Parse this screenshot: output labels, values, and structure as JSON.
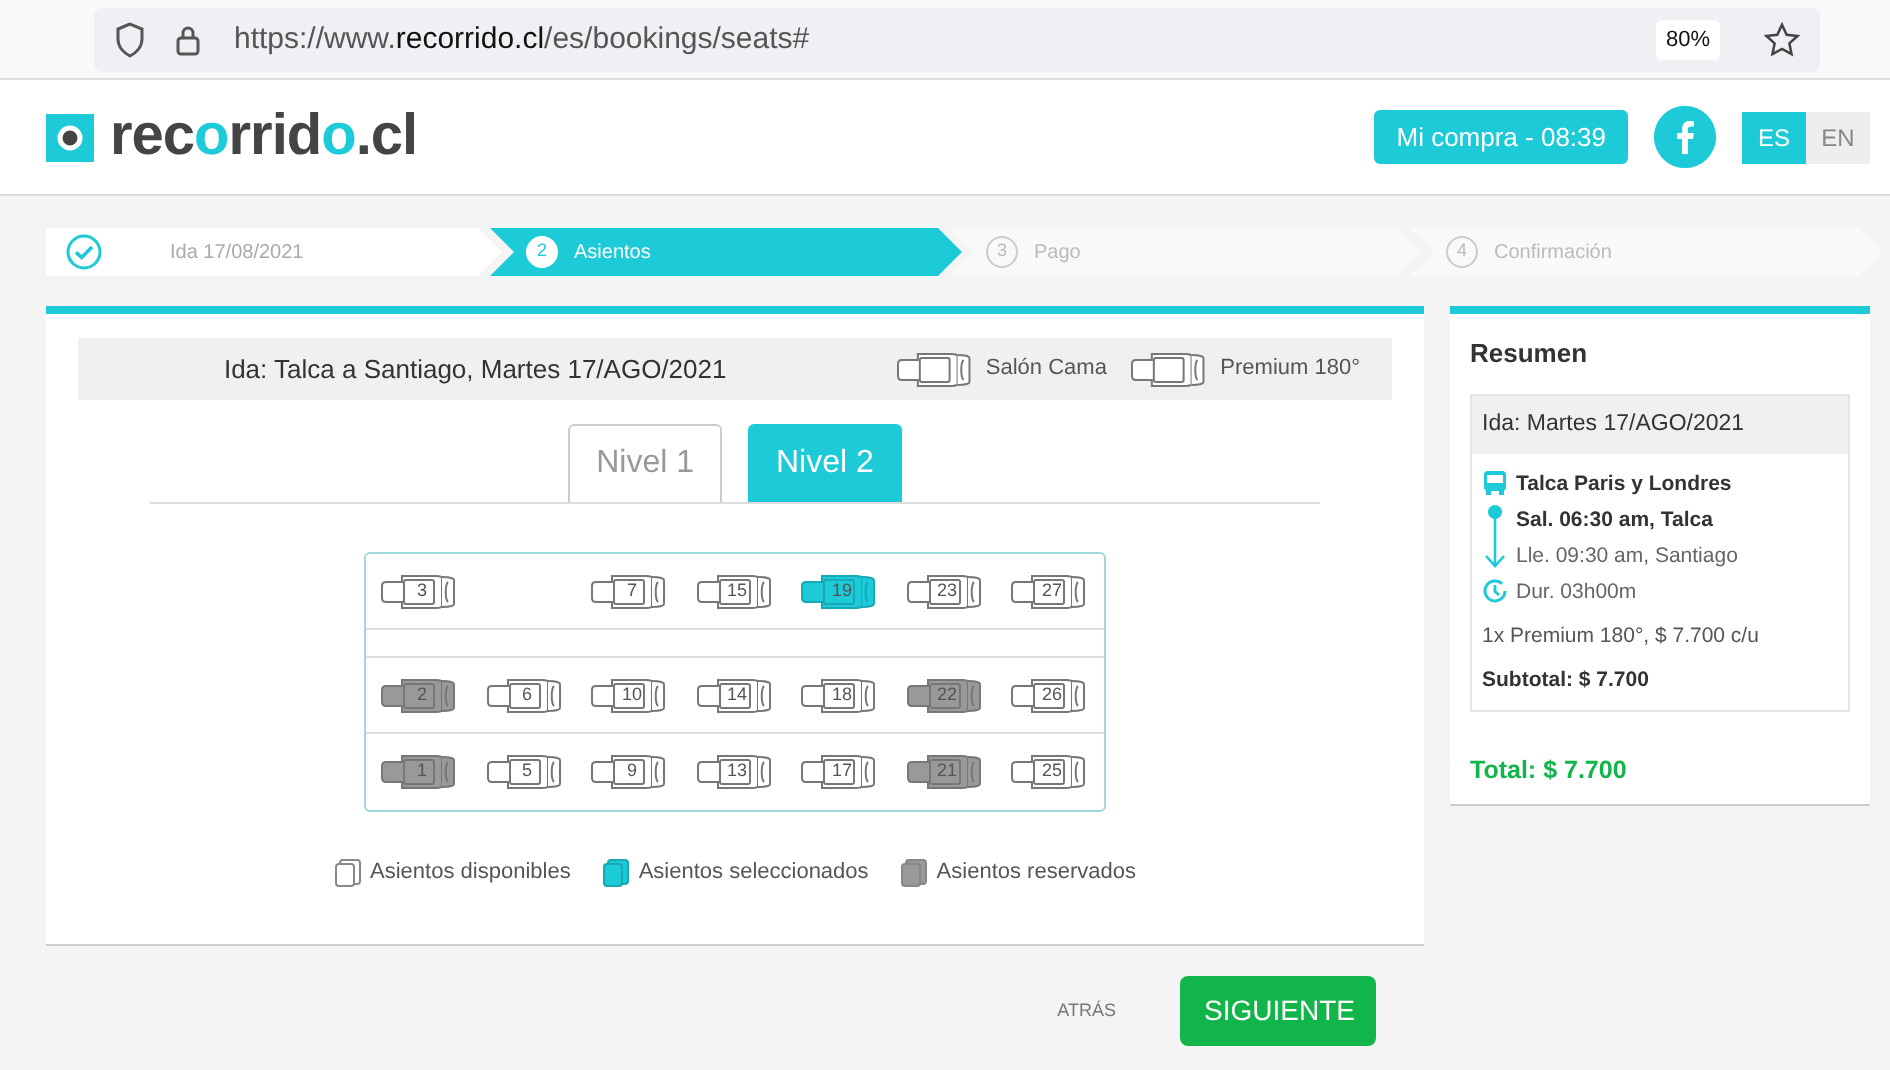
{
  "browser": {
    "url_prefix": "https://www.",
    "url_domain": "recorrido.cl",
    "url_path": "/es/bookings/seats#",
    "zoom": "80%"
  },
  "header": {
    "logo_parts": [
      "rec",
      "o",
      "rrid",
      "o",
      ".cl"
    ],
    "cart_button": "Mi compra - 08:39",
    "languages": [
      {
        "label": "ES",
        "selected": true
      },
      {
        "label": "EN",
        "selected": false
      }
    ]
  },
  "steps": [
    {
      "label": "Ida 17/08/2021",
      "completed": true,
      "selected": false
    },
    {
      "number": "2",
      "label": "Asientos",
      "completed": false,
      "selected": true
    },
    {
      "number": "3",
      "label": "Pago",
      "completed": false,
      "selected": false
    },
    {
      "number": "4",
      "label": "Confirmación",
      "completed": false,
      "selected": false
    }
  ],
  "trip_bar": {
    "title": "Ida: Talca a Santiago, Martes 17/AGO/2021",
    "seat_types": [
      "Salón Cama",
      "Premium 180°"
    ]
  },
  "levels": [
    {
      "label": "Nivel 1",
      "selected": false
    },
    {
      "label": "Nivel 2",
      "selected": true
    }
  ],
  "seat_rows": [
    [
      {
        "kind": "seat",
        "number": "3",
        "selected": false,
        "reserved": false
      },
      {
        "kind": "gap"
      },
      {
        "kind": "seat",
        "number": "7",
        "selected": false,
        "reserved": false
      },
      {
        "kind": "seat",
        "number": "15",
        "selected": false,
        "reserved": false
      },
      {
        "kind": "seat",
        "number": "19",
        "selected": true,
        "reserved": false
      },
      {
        "kind": "seat",
        "number": "23",
        "selected": false,
        "reserved": false
      },
      {
        "kind": "seat",
        "number": "27",
        "selected": false,
        "reserved": false
      }
    ],
    [],
    [
      {
        "kind": "seat",
        "number": "2",
        "selected": false,
        "reserved": true
      },
      {
        "kind": "seat",
        "number": "6",
        "selected": false,
        "reserved": false
      },
      {
        "kind": "seat",
        "number": "10",
        "selected": false,
        "reserved": false
      },
      {
        "kind": "seat",
        "number": "14",
        "selected": false,
        "reserved": false
      },
      {
        "kind": "seat",
        "number": "18",
        "selected": false,
        "reserved": false
      },
      {
        "kind": "seat",
        "number": "22",
        "selected": false,
        "reserved": true
      },
      {
        "kind": "seat",
        "number": "26",
        "selected": false,
        "reserved": false
      }
    ],
    [
      {
        "kind": "seat",
        "number": "1",
        "selected": false,
        "reserved": true
      },
      {
        "kind": "seat",
        "number": "5",
        "selected": false,
        "reserved": false
      },
      {
        "kind": "seat",
        "number": "9",
        "selected": false,
        "reserved": false
      },
      {
        "kind": "seat",
        "number": "13",
        "selected": false,
        "reserved": false
      },
      {
        "kind": "seat",
        "number": "17",
        "selected": false,
        "reserved": false
      },
      {
        "kind": "seat",
        "number": "21",
        "selected": false,
        "reserved": true
      },
      {
        "kind": "seat",
        "number": "25",
        "selected": false,
        "reserved": false
      }
    ]
  ],
  "legend": [
    {
      "label": "Asientos disponibles",
      "kind": "available"
    },
    {
      "label": "Asientos seleccionados",
      "kind": "selected"
    },
    {
      "label": "Asientos reservados",
      "kind": "reserved"
    }
  ],
  "footer": {
    "back": "ATRÁS",
    "next": "SIGUIENTE"
  },
  "summary": {
    "title": "Resumen",
    "trip_header": "Ida: Martes 17/AGO/2021",
    "company": "Talca Paris y Londres",
    "departure": "Sal. 06:30 am, Talca",
    "arrival": "Lle. 09:30 am, Santiago",
    "duration": "Dur.  03h00m",
    "ticket": "1x Premium 180°, $ 7.700 c/u",
    "subtotal": "Subtotal: $ 7.700",
    "total": "Total: $ 7.700"
  }
}
